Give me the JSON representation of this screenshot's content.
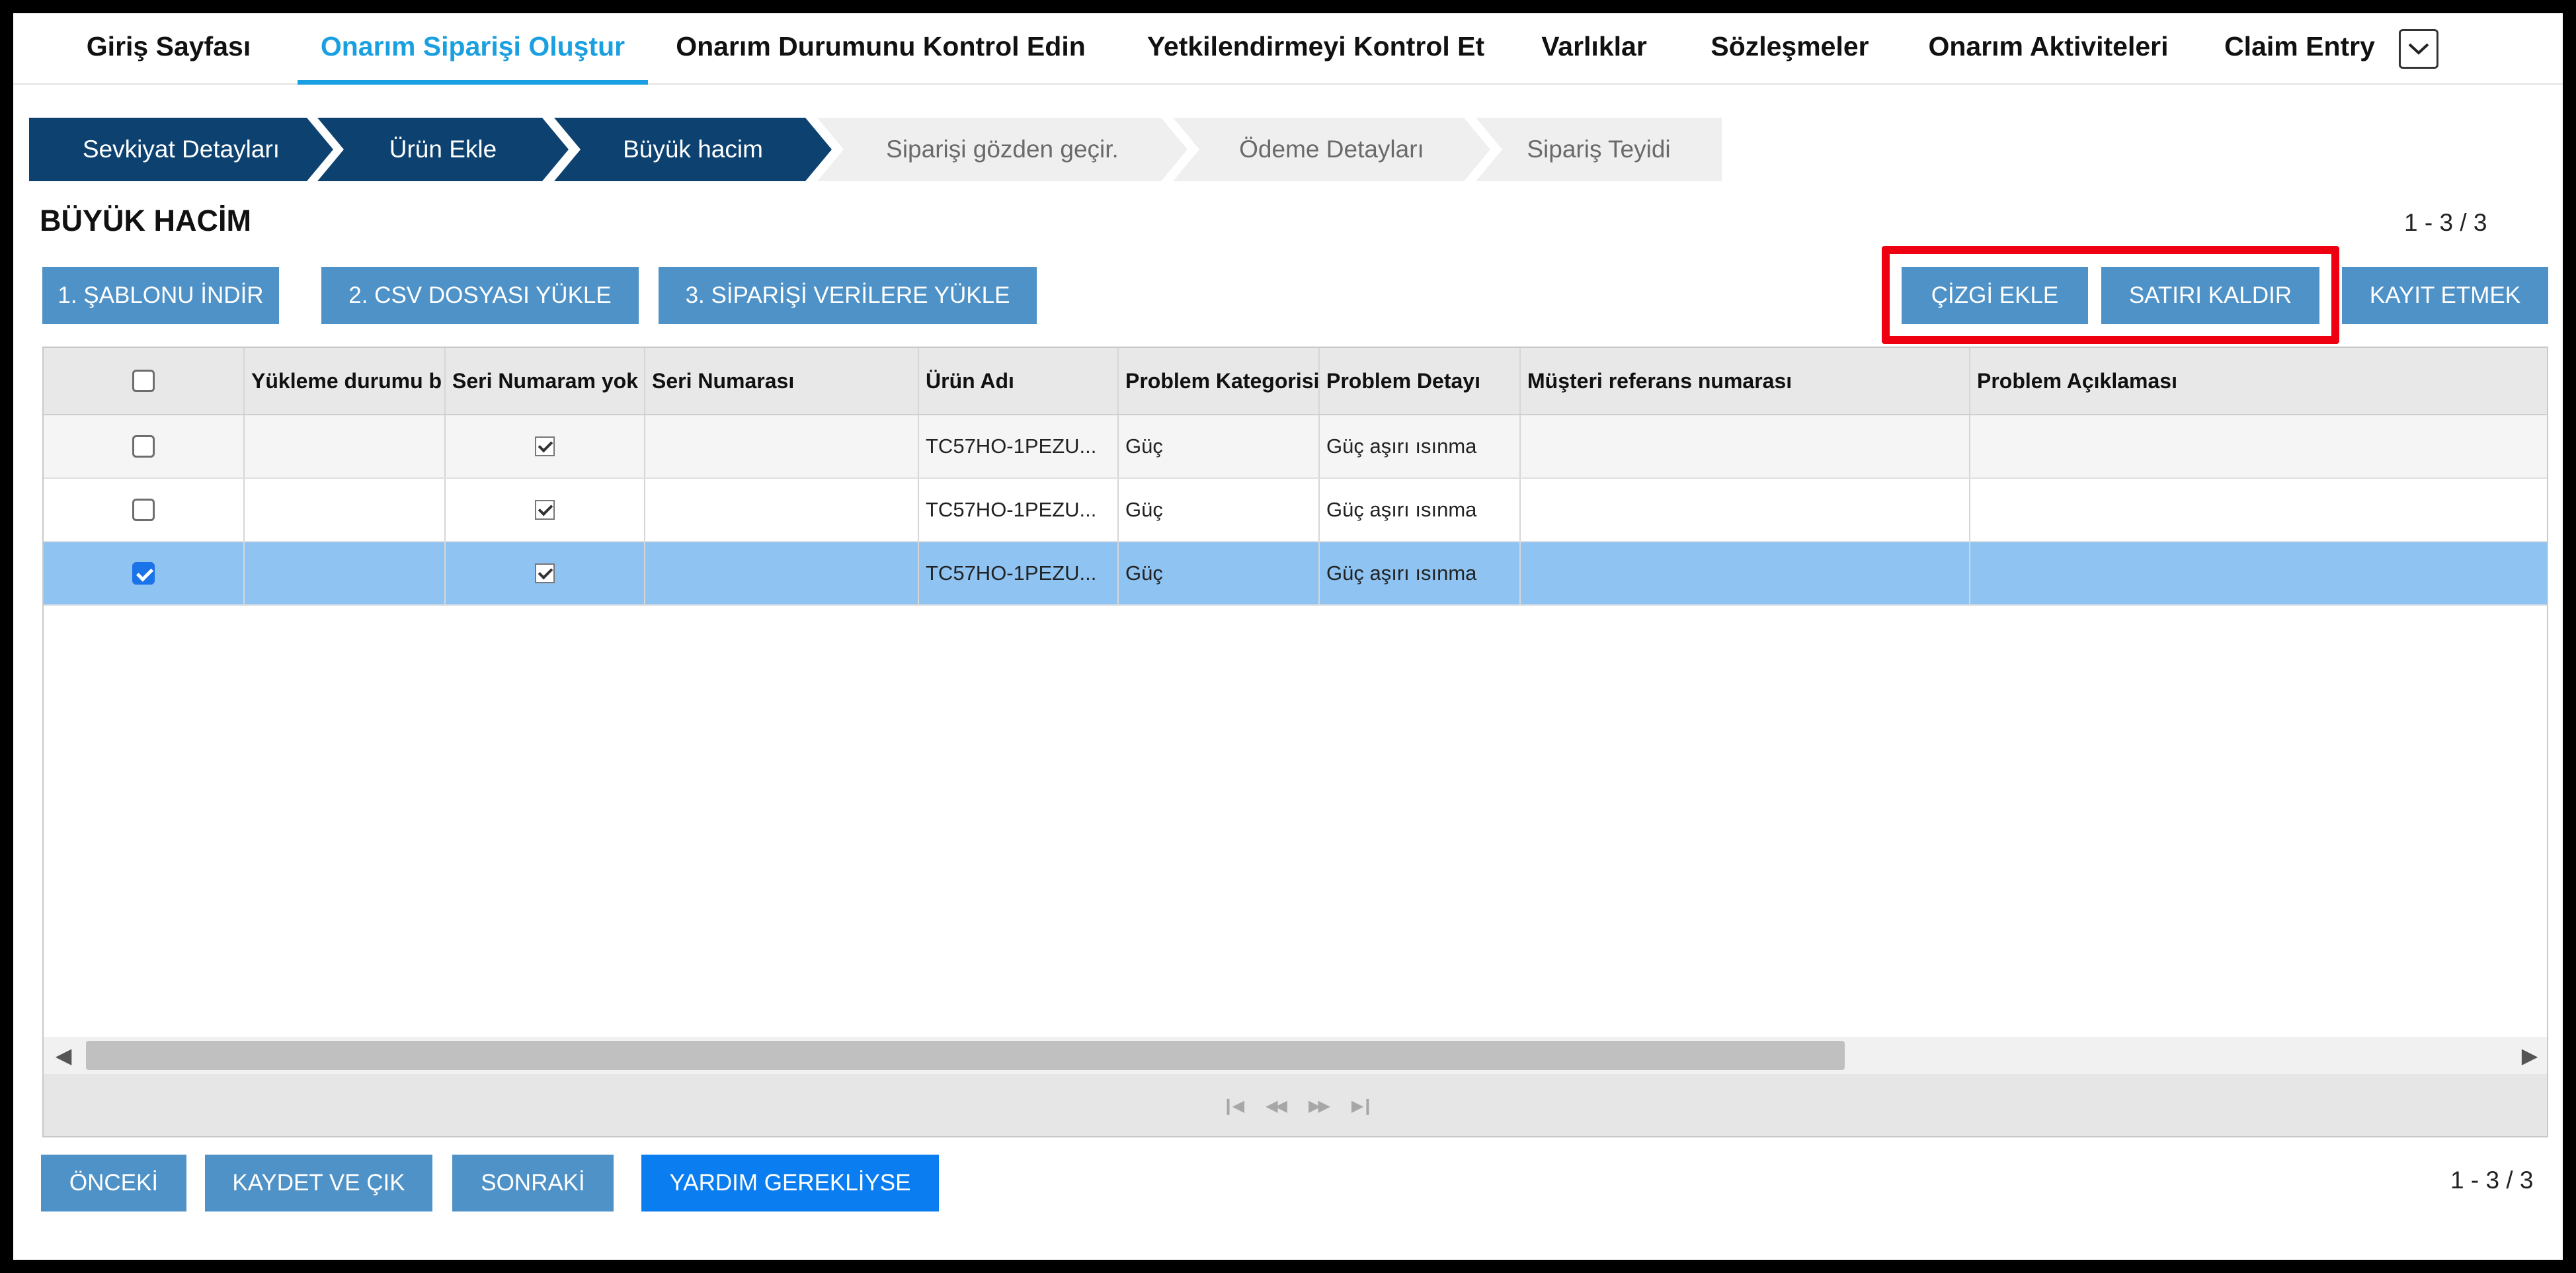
{
  "nav": {
    "items": [
      {
        "label": "Giriş Sayfası"
      },
      {
        "label": "Onarım Siparişi Oluştur"
      },
      {
        "label": "Onarım Durumunu Kontrol Edin"
      },
      {
        "label": "Yetkilendirmeyi Kontrol Et"
      },
      {
        "label": "Varlıklar"
      },
      {
        "label": "Sözleşmeler"
      },
      {
        "label": "Onarım Aktiviteleri"
      },
      {
        "label": "Claim Entry"
      }
    ],
    "active": "Onarım Siparişi Oluştur",
    "more_icon": "chevron-down-icon"
  },
  "steps": [
    {
      "label": "Sevkiyat Detayları",
      "state": "done"
    },
    {
      "label": "Ürün Ekle",
      "state": "done"
    },
    {
      "label": "Büyük hacim",
      "state": "current"
    },
    {
      "label": "Siparişi gözden geçir.",
      "state": "todo"
    },
    {
      "label": "Ödeme Detayları",
      "state": "todo"
    },
    {
      "label": "Sipariş Teyidi",
      "state": "todo"
    }
  ],
  "section": {
    "title": "BÜYÜK HACİM",
    "record_count_top": "1 - 3 / 3",
    "record_count_bottom": "1 - 3 / 3"
  },
  "toolbar": {
    "download_template": "1. ŞABLONU İNDİR",
    "upload_csv": "2. CSV DOSYASI YÜKLE",
    "load_order_data": "3. SİPARİŞİ VERİLERE YÜKLE",
    "add_line": "ÇİZGİ EKLE",
    "remove_row": "SATIRI KALDIR",
    "save": "KAYIT ETMEK"
  },
  "grid": {
    "columns": [
      "",
      "Yükleme durumu b",
      "Seri Numaram yok",
      "Seri Numarası",
      "Ürün Adı",
      "Problem Kategorisi",
      "Problem Detayı",
      "Müşteri referans numarası",
      "Problem Açıklaması"
    ],
    "rows": [
      {
        "selected": false,
        "upload_status": "",
        "no_serial": true,
        "serial": "",
        "product": "TC57HO-1PEZU...",
        "category": "Güç",
        "detail": "Güç aşırı ısınma",
        "customer_ref": "",
        "description": ""
      },
      {
        "selected": false,
        "upload_status": "",
        "no_serial": true,
        "serial": "",
        "product": "TC57HO-1PEZU...",
        "category": "Güç",
        "detail": "Güç aşırı ısınma",
        "customer_ref": "",
        "description": ""
      },
      {
        "selected": true,
        "upload_status": "",
        "no_serial": true,
        "serial": "",
        "product": "TC57HO-1PEZU...",
        "category": "Güç",
        "detail": "Güç aşırı ısınma",
        "customer_ref": "",
        "description": ""
      }
    ],
    "pager_icons": [
      "first-page-icon",
      "prev-page-icon",
      "next-page-icon",
      "last-page-icon"
    ]
  },
  "footer": {
    "previous": "ÖNCEKİ",
    "save_exit": "KAYDET VE ÇIK",
    "next": "SONRAKİ",
    "help": "YARDIM GEREKLİYSE"
  },
  "colors": {
    "nav_active": "#1aa0e0",
    "step_done": "#0d4270",
    "step_todo": "#efefef",
    "button": "#4e92c8",
    "button_primary": "#0a7df0",
    "row_selected": "#8ec3f2",
    "annotation_box": "#ee0010"
  }
}
